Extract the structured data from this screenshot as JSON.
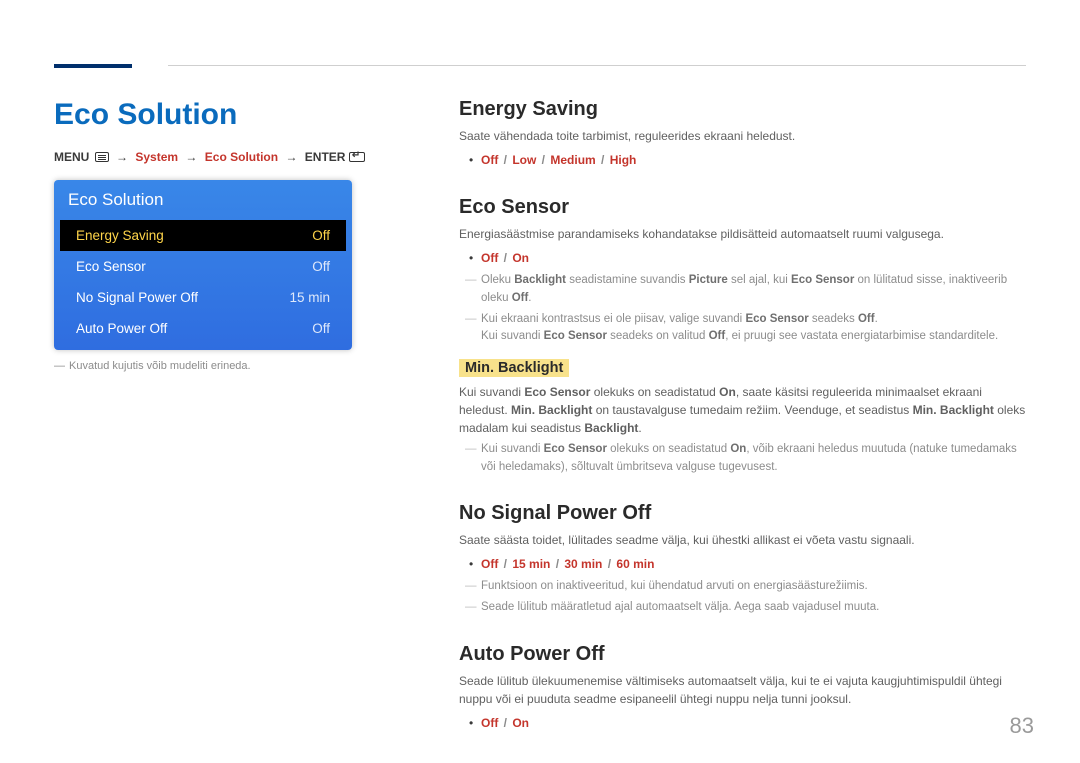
{
  "page_number": "83",
  "left": {
    "title": "Eco Solution",
    "breadcrumb": {
      "menu": "MENU",
      "path1": "System",
      "path2": "Eco Solution",
      "enter": "ENTER"
    },
    "osd": {
      "title": "Eco Solution",
      "rows": [
        {
          "label": "Energy Saving",
          "value": "Off",
          "selected": true
        },
        {
          "label": "Eco Sensor",
          "value": "Off",
          "selected": false
        },
        {
          "label": "No Signal Power Off",
          "value": "15 min",
          "selected": false
        },
        {
          "label": "Auto Power Off",
          "value": "Off",
          "selected": false
        }
      ]
    },
    "footnote": "Kuvatud kujutis võib mudeliti erineda."
  },
  "right": {
    "energy_saving": {
      "heading": "Energy Saving",
      "body": "Saate vähendada toite tarbimist, reguleerides ekraani heledust.",
      "options": [
        "Off",
        "Low",
        "Medium",
        "High"
      ]
    },
    "eco_sensor": {
      "heading": "Eco Sensor",
      "body": "Energiasäästmise parandamiseks kohandatakse pildisätteid automaatselt ruumi valgusega.",
      "options": [
        "Off",
        "On"
      ],
      "note1_pre": "Oleku ",
      "note1_b1": "Backlight",
      "note1_mid1": " seadistamine suvandis ",
      "note1_b2": "Picture",
      "note1_mid2": " sel ajal, kui ",
      "note1_b3": "Eco Sensor",
      "note1_mid3": " on lülitatud sisse, inaktiveerib oleku ",
      "note1_b4": "Off",
      "note1_post": ".",
      "note2_pre": "Kui ekraani kontrastsus ei ole piisav, valige suvandi ",
      "note2_b1": "Eco Sensor",
      "note2_mid": " seadeks ",
      "note2_b2": "Off",
      "note2_post": ".",
      "note2b_pre": "Kui suvandi ",
      "note2b_b1": "Eco Sensor",
      "note2b_mid": " seadeks on valitud ",
      "note2b_b2": "Off",
      "note2b_post": ", ei pruugi see vastata energiatarbimise standarditele.",
      "min_backlight": {
        "heading": "Min. Backlight",
        "body_pre": "Kui suvandi ",
        "body_b1": "Eco Sensor",
        "body_mid1": " olekuks on seadistatud ",
        "body_b2": "On",
        "body_mid2": ", saate käsitsi reguleerida minimaalset ekraani heledust. ",
        "body_b3": "Min. Backlight",
        "body_mid3": " on taustavalguse tumedaim režiim. Veenduge, et seadistus ",
        "body_b4": "Min. Backlight",
        "body_mid4": " oleks madalam kui seadistus ",
        "body_b5": "Backlight",
        "body_post": ".",
        "note_pre": "Kui suvandi ",
        "note_b1": "Eco Sensor",
        "note_mid": " olekuks on seadistatud ",
        "note_b2": "On",
        "note_post": ", võib ekraani heledus muutuda (natuke tumedamaks või heledamaks), sõltuvalt ümbritseva valguse tugevusest."
      }
    },
    "no_signal": {
      "heading": "No Signal Power Off",
      "body": "Saate säästa toidet, lülitades seadme välja, kui ühestki allikast ei võeta vastu signaali.",
      "options": [
        "Off",
        "15 min",
        "30 min",
        "60 min"
      ],
      "note1": "Funktsioon on inaktiveeritud, kui ühendatud arvuti on energiasäästurežiimis.",
      "note2": "Seade lülitub määratletud ajal automaatselt välja. Aega saab vajadusel muuta."
    },
    "auto_power": {
      "heading": "Auto Power Off",
      "body": "Seade lülitub ülekuumenemise vältimiseks automaatselt välja, kui te ei vajuta kaugjuhtimispuldil ühtegi nuppu või ei puuduta seadme esipaneelil ühtegi nuppu nelja tunni jooksul.",
      "options": [
        "Off",
        "On"
      ]
    }
  }
}
